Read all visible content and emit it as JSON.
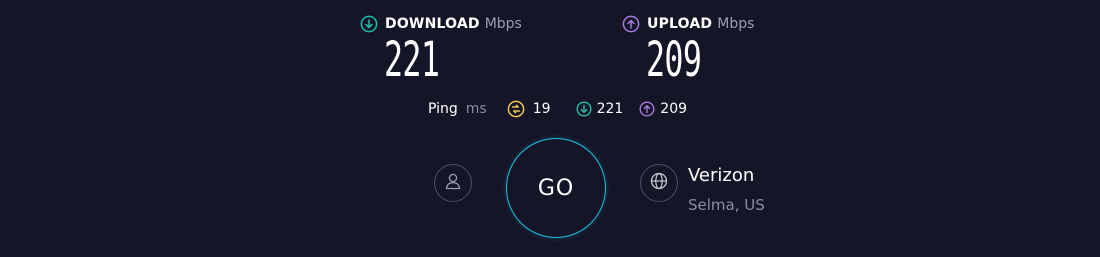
{
  "download": {
    "label": "DOWNLOAD",
    "unit": "Mbps",
    "value": "221",
    "icon": "download-arrow-icon",
    "color": "#20c1b0"
  },
  "upload": {
    "label": "UPLOAD",
    "unit": "Mbps",
    "value": "209",
    "icon": "upload-arrow-icon",
    "color": "#a77bd9"
  },
  "ping": {
    "label": "Ping",
    "unit": "ms",
    "latency": "19",
    "latency_icon": "latency-icon",
    "latency_color": "#f3c55c",
    "download": "221",
    "upload": "209"
  },
  "controls": {
    "go_label": "GO",
    "go_color": "#20c1e0",
    "profile_icon": "user-icon",
    "globe_icon": "globe-icon"
  },
  "isp": {
    "name": "Verizon",
    "location": "Selma, US"
  }
}
